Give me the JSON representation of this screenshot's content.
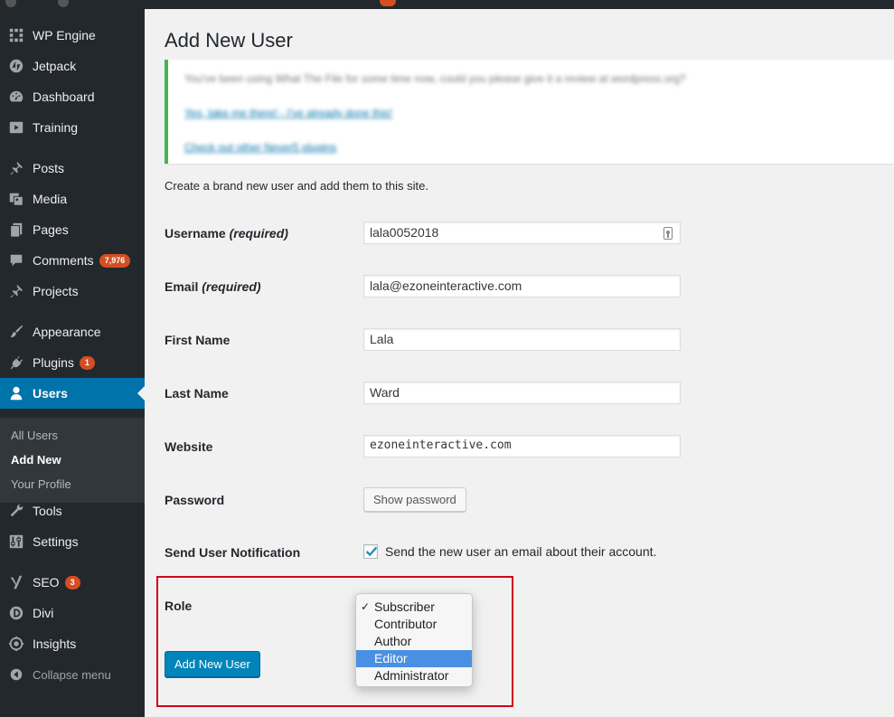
{
  "sidebar": {
    "items": [
      {
        "label": "WP Engine",
        "icon": "grid-icon"
      },
      {
        "label": "Jetpack",
        "icon": "jetpack-icon"
      },
      {
        "label": "Dashboard",
        "icon": "dashboard-icon"
      },
      {
        "label": "Training",
        "icon": "training-icon"
      },
      {
        "label": "Posts",
        "icon": "pin-icon"
      },
      {
        "label": "Media",
        "icon": "media-icon"
      },
      {
        "label": "Pages",
        "icon": "pages-icon"
      },
      {
        "label": "Comments",
        "icon": "comment-icon",
        "badge": "7,976"
      },
      {
        "label": "Projects",
        "icon": "pin-icon"
      },
      {
        "label": "Appearance",
        "icon": "brush-icon"
      },
      {
        "label": "Plugins",
        "icon": "plug-icon",
        "badge": "1"
      },
      {
        "label": "Users",
        "icon": "user-icon",
        "current": true
      },
      {
        "label": "Tools",
        "icon": "wrench-icon"
      },
      {
        "label": "Settings",
        "icon": "settings-icon"
      },
      {
        "label": "SEO",
        "icon": "yoast-icon",
        "badge": "3"
      },
      {
        "label": "Divi",
        "icon": "divi-icon"
      },
      {
        "label": "Insights",
        "icon": "insights-icon"
      },
      {
        "label": "Collapse menu",
        "icon": "collapse-icon"
      }
    ],
    "submenu": [
      "All Users",
      "Add New",
      "Your Profile"
    ]
  },
  "page": {
    "title": "Add New User",
    "intro": "Create a brand new user and add them to this site."
  },
  "notice": {
    "line1": "You've been using What The File for some time now, could you please give it a review at wordpress.org?",
    "line2": "Yes, take me there!  -  I've already done this!",
    "line3": "Check out other Never5 plugins"
  },
  "form": {
    "username_label": "Username",
    "username_req": "(required)",
    "username_value": "lala0052018",
    "email_label": "Email",
    "email_req": "(required)",
    "email_value": "lala@ezoneinteractive.com",
    "first_name_label": "First Name",
    "first_name_value": "Lala",
    "last_name_label": "Last Name",
    "last_name_value": "Ward",
    "website_label": "Website",
    "website_value": "ezoneinteractive.com",
    "password_label": "Password",
    "show_password_label": "Show password",
    "notification_label": "Send User Notification",
    "notification_text": "Send the new user an email about their account.",
    "notification_checked": true,
    "role_label": "Role",
    "role_options": [
      "Subscriber",
      "Contributor",
      "Author",
      "Editor",
      "Administrator"
    ],
    "role_selected": "Subscriber",
    "role_highlighted": "Editor",
    "submit_label": "Add New User"
  },
  "colors": {
    "accent": "#0073aa",
    "sidebar_bg": "#23282d",
    "badge": "#d54e21",
    "highlight_box": "#d0021b",
    "notice_border": "#46b450"
  }
}
